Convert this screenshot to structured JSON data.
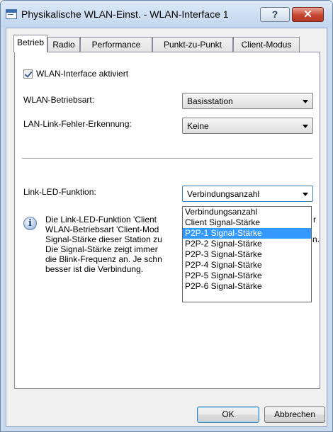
{
  "window": {
    "title": "Physikalische WLAN-Einst. - WLAN-Interface 1",
    "help_label": "?",
    "close_label": "✕"
  },
  "tabs": [
    {
      "label": "Betrieb",
      "active": true
    },
    {
      "label": "Radio"
    },
    {
      "label": "Performance"
    },
    {
      "label": "Punkt-zu-Punkt"
    },
    {
      "label": "Client-Modus"
    }
  ],
  "operation": {
    "wlan_enabled_label": "WLAN-Interface aktiviert",
    "wlan_enabled_checked": true,
    "mode_label": "WLAN-Betriebsart:",
    "mode_value": "Basisstation",
    "lan_link_label": "LAN-Link-Fehler-Erkennung:",
    "lan_link_value": "Keine",
    "led_label": "Link-LED-Funktion:",
    "led_value": "Verbindungsanzahl",
    "led_options": [
      "Verbindungsanzahl",
      "Client Signal-Stärke",
      "P2P-1 Signal-Stärke",
      "P2P-2 Signal-Stärke",
      "P2P-3 Signal-Stärke",
      "P2P-4 Signal-Stärke",
      "P2P-5 Signal-Stärke",
      "P2P-6 Signal-Stärke"
    ],
    "led_highlighted_index": 2
  },
  "info": {
    "icon": "info-icon",
    "lines": [
      "Die Link-LED-Funktion 'Client",
      "WLAN-Betriebsart 'Client-Mod",
      "Signal-Stärke dieser Station zu",
      "Die Signal-Stärke zeigt immer",
      "die Blink-Frequenz an. Je schn",
      "besser ist die Verbindung."
    ],
    "overflow_char_1": "r",
    "overflow_char_2": "n."
  },
  "footer": {
    "ok_label": "OK",
    "cancel_label": "Abbrechen"
  }
}
